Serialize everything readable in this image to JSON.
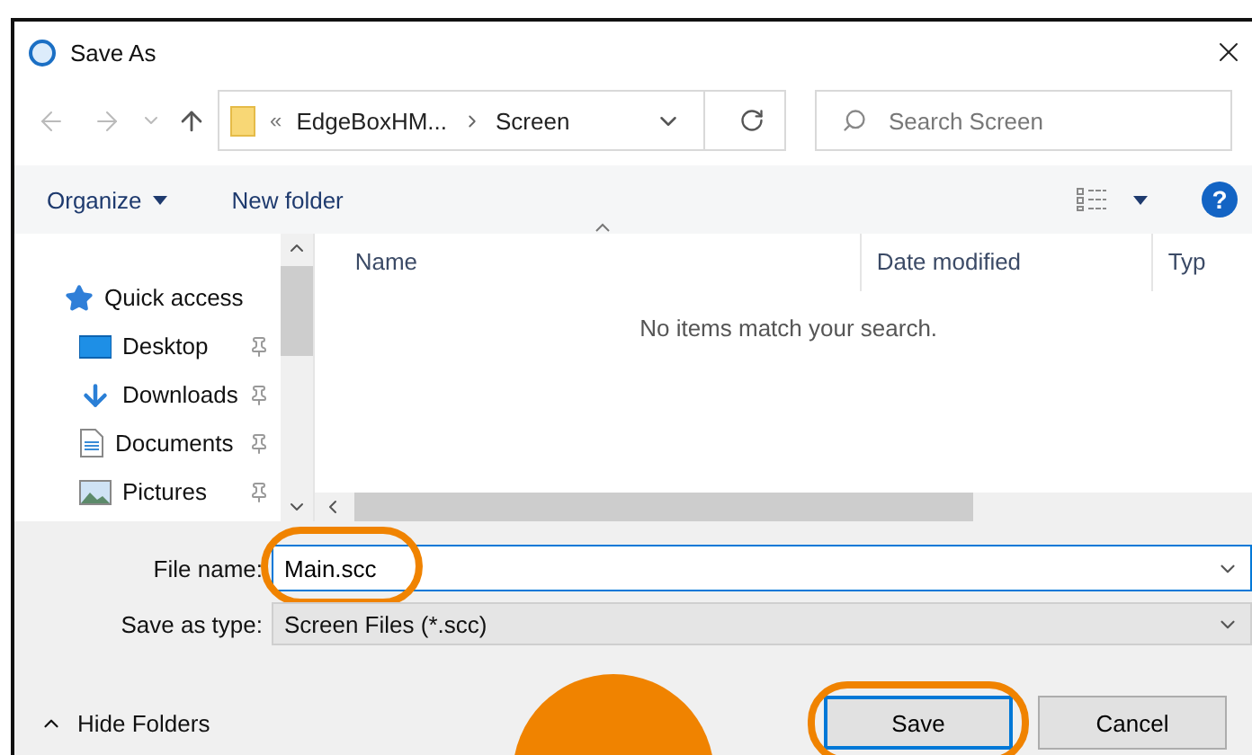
{
  "window": {
    "title": "Save As"
  },
  "address_bar": {
    "overflow": "«",
    "path": [
      "EdgeBoxHM...",
      "Screen"
    ]
  },
  "search": {
    "placeholder": "Search Screen"
  },
  "toolbar": {
    "organize": "Organize",
    "new_folder": "New folder",
    "help": "?"
  },
  "nav": {
    "items": [
      {
        "label": "Quick access",
        "kind": "star",
        "pinned": false
      },
      {
        "label": "Desktop",
        "kind": "desktop",
        "pinned": true
      },
      {
        "label": "Downloads",
        "kind": "download",
        "pinned": true
      },
      {
        "label": "Documents",
        "kind": "document",
        "pinned": true
      },
      {
        "label": "Pictures",
        "kind": "picture",
        "pinned": true
      }
    ]
  },
  "content": {
    "columns": [
      {
        "label": "Name",
        "sorted": true
      },
      {
        "label": "Date modified",
        "sorted": false
      },
      {
        "label": "Typ",
        "sorted": false
      }
    ],
    "empty_message": "No items match your search."
  },
  "form": {
    "file_name": {
      "label": "File name:",
      "value": "Main.scc",
      "highlighted": true
    },
    "save_type": {
      "label": "Save as type:",
      "value": "Screen Files (*.scc)"
    }
  },
  "footer": {
    "hide_folders": "Hide Folders",
    "buttons": [
      {
        "label": "Save",
        "default": true,
        "highlighted": true
      },
      {
        "label": "Cancel",
        "default": false,
        "highlighted": false
      }
    ]
  },
  "step_badge": {
    "visible": true
  }
}
